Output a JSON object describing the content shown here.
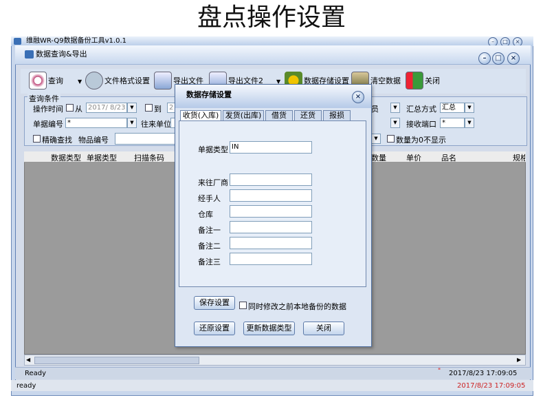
{
  "page_heading": "盘点操作设置",
  "outer_window": {
    "title": "维融WR-Q9数据备份工具v1.0.1"
  },
  "main_window": {
    "title": "数据查询&导出"
  },
  "toolbar": {
    "items": [
      {
        "label": "查询",
        "icon": "search-icon"
      },
      {
        "label": "文件格式设置",
        "icon": "arrows-icon"
      },
      {
        "label": "导出文件",
        "icon": "export-file-icon"
      },
      {
        "label": "导出文件2",
        "icon": "export-file2-icon"
      },
      {
        "label": "数据存储设置",
        "icon": "gears-icon"
      },
      {
        "label": "清空数据",
        "icon": "trash-icon"
      },
      {
        "label": "关闭",
        "icon": "exit-icon"
      }
    ]
  },
  "query": {
    "group_label": "查询条件",
    "op_time_label": "操作时间",
    "from_label": "从",
    "from_date": "2017/ 8/23",
    "to_label": "到",
    "to_date_partial": "2",
    "bill_no_label": "单据编号",
    "bill_no_value": "*",
    "partner_label": "往来单位",
    "exact_label": "精确查找",
    "item_no_label": "物品编号",
    "partial_select": "员",
    "summary_label": "汇总方式",
    "summary_value": "汇总",
    "port_label": "接收端口",
    "port_value": "*",
    "hide_zero_label": "数量为0不显示"
  },
  "grid": {
    "columns": [
      "数据类型",
      "单据类型",
      "扫描条码",
      "数量",
      "单价",
      "品名",
      "规格"
    ]
  },
  "status": {
    "text": "Ready",
    "datetime": "2017/8/23 17:09:05",
    "bottom_text": "ready",
    "bottom_datetime": "2017/8/23 17:09:05"
  },
  "dialog": {
    "title": "数据存储设置",
    "tabs": [
      "收货(入库)",
      "发货(出库)",
      "借货",
      "还货",
      "报损"
    ],
    "fields": [
      {
        "label": "单据类型",
        "value": "IN"
      },
      {
        "label": "来往厂商",
        "value": ""
      },
      {
        "label": "经手人",
        "value": ""
      },
      {
        "label": "仓库",
        "value": ""
      },
      {
        "label": "备注一",
        "value": ""
      },
      {
        "label": "备注二",
        "value": ""
      },
      {
        "label": "备注三",
        "value": ""
      }
    ],
    "save_button": "保存设置",
    "modify_checkbox": "同时修改之前本地备份的数据",
    "restore_button": "还原设置",
    "update_button": "更新数据类型",
    "close_button": "关闭"
  },
  "colors": {
    "accent": "#4f6f9f",
    "window_bg": "#d4dcea"
  }
}
